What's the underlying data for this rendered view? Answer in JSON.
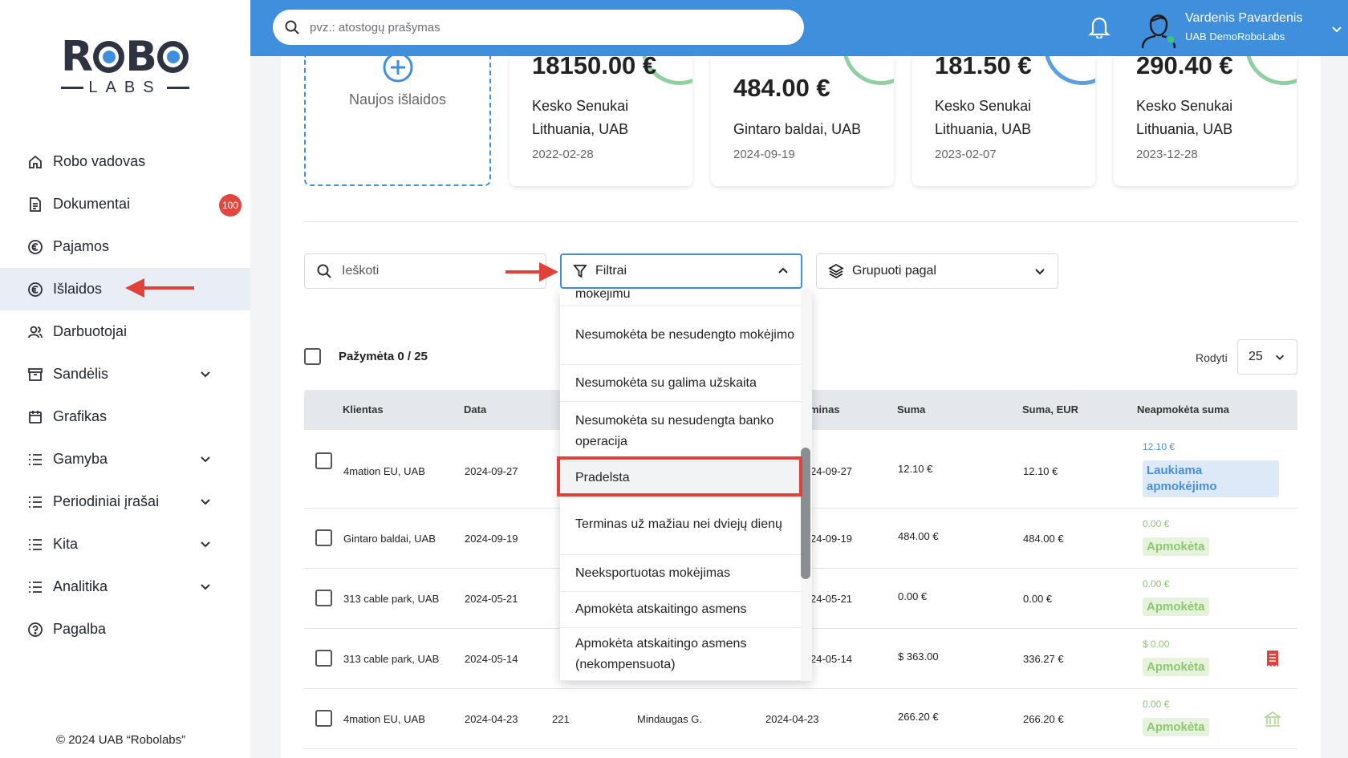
{
  "search": {
    "placeholder": "pvz.: atostogų prašymas"
  },
  "user": {
    "name": "Vardenis Pavardenis",
    "company": "UAB DemoRoboLabs"
  },
  "logo": {
    "top": "ROBO",
    "bottom": "LABS"
  },
  "sidebar": {
    "items": [
      {
        "label": "Robo vadovas",
        "icon": "home-icon"
      },
      {
        "label": "Dokumentai",
        "icon": "document-icon",
        "badge": "100"
      },
      {
        "label": "Pajamos",
        "icon": "euro-circle-icon"
      },
      {
        "label": "Išlaidos",
        "icon": "euro-circle-icon",
        "active": true
      },
      {
        "label": "Darbuotojai",
        "icon": "users-icon"
      },
      {
        "label": "Sandėlis",
        "icon": "archive-icon",
        "expandable": true
      },
      {
        "label": "Grafikas",
        "icon": "calendar-icon"
      },
      {
        "label": "Gamyba",
        "icon": "list-icon",
        "expandable": true
      },
      {
        "label": "Periodiniai įrašai",
        "icon": "list-icon",
        "expandable": true
      },
      {
        "label": "Kita",
        "icon": "list-icon",
        "expandable": true
      },
      {
        "label": "Analitika",
        "icon": "list-icon",
        "expandable": true
      },
      {
        "label": "Pagalba",
        "icon": "help-circle-icon"
      }
    ],
    "copyright": "© 2024 UAB “Robolabs”"
  },
  "cards": {
    "new_label": "Naujos išlaidos",
    "items": [
      {
        "amount": "18150.00 €",
        "vendor": "Kesko Senukai Lithuania, UAB",
        "date": "2022-02-28"
      },
      {
        "amount": "484.00 €",
        "vendor": "Gintaro baldai, UAB",
        "date": "2024-09-19"
      },
      {
        "amount": "181.50 €",
        "vendor": "Kesko Senukai Lithuania, UAB",
        "date": "2023-02-07"
      },
      {
        "amount": "290.40 €",
        "vendor": "Kesko Senukai Lithuania, UAB",
        "date": "2023-12-28"
      }
    ]
  },
  "toolbar": {
    "search_placeholder": "Ieškoti",
    "filter_label": "Filtrai",
    "group_label": "Grupuoti pagal",
    "selected": "Pažymėta 0 / 25",
    "show_label": "Rodyti",
    "show_value": "25"
  },
  "table": {
    "headers": [
      "Klientas",
      "Data",
      "minas",
      "Suma",
      "Suma, EUR",
      "Neapmokėta suma"
    ],
    "rows": [
      {
        "client": "4mation EU, UAB",
        "date": "2024-09-27",
        "num": "",
        "person": "",
        "due": "24-09-27",
        "sum": "12.10 €",
        "sum_eur": "12.10 €",
        "unpaid": "12.10 €",
        "status": "Laukiama apmokėjimo",
        "status_type": "waiting"
      },
      {
        "client": "Gintaro baldai, UAB",
        "date": "2024-09-19",
        "num": "",
        "person": "",
        "due": "24-09-19",
        "sum": "484.00 €",
        "sum_eur": "484.00 €",
        "unpaid": "0.00 €",
        "status": "Apmokėta",
        "status_type": "paid"
      },
      {
        "client": "313 cable park, UAB",
        "date": "2024-05-21",
        "num": "",
        "person": "",
        "due": "24-05-21",
        "sum": "0.00 €",
        "sum_eur": "0.00 €",
        "unpaid": "0.00 €",
        "status": "Apmokėta",
        "status_type": "paid"
      },
      {
        "client": "313 cable park, UAB",
        "date": "2024-05-14",
        "num": "",
        "person": "",
        "due": "24-05-14",
        "sum": "$ 363.00",
        "sum_eur": "336.27 €",
        "unpaid": "$ 0.00",
        "status": "Apmokėta",
        "status_type": "paid",
        "icon": "receipt-icon"
      },
      {
        "client": "4mation EU, UAB",
        "date": "2024-04-23",
        "num": "221",
        "person": "Mindaugas G.",
        "due": "2024-04-23",
        "sum": "266.20 €",
        "sum_eur": "266.20 €",
        "unpaid": "0.00 €",
        "status": "Apmokėta",
        "status_type": "paid",
        "icon": "bank-icon"
      }
    ]
  },
  "filter_dropdown": {
    "items": [
      "mokėjimu",
      "Nesumokėta be nesudengto mokėjimo",
      "Nesumokėta su galima užskaita",
      "Nesumokėta su nesudengta banko operacija",
      "Pradelsta",
      "Terminas už mažiau nei dviejų dienų",
      "Neeksportuotas mokėjimas",
      "Apmokėta atskaitingo asmens",
      "Apmokėta atskaitingo asmens (nekompensuota)"
    ],
    "highlighted": "Pradelsta"
  },
  "colors": {
    "accent": "#3f8fdc",
    "annotation": "#e0413a",
    "paid": "#8cc66e",
    "badge": "#e0473e"
  }
}
